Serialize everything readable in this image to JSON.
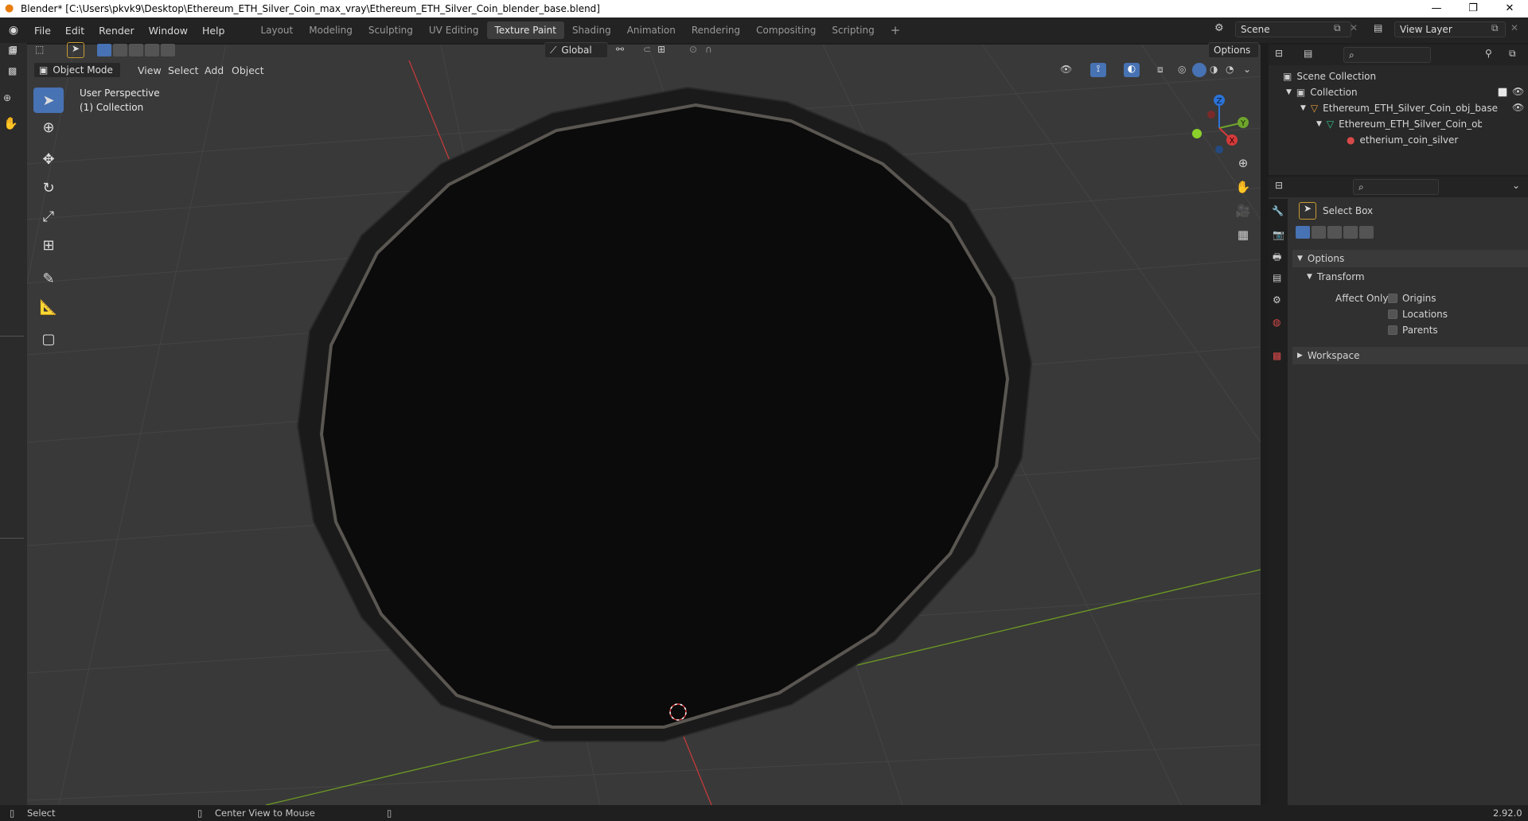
{
  "window": {
    "title": "Blender* [C:\\Users\\pkvk9\\Desktop\\Ethereum_ETH_Silver_Coin_max_vray\\Ethereum_ETH_Silver_Coin_blender_base.blend]"
  },
  "menu": {
    "items": [
      "File",
      "Edit",
      "Render",
      "Window",
      "Help"
    ]
  },
  "workspaces": {
    "tabs": [
      "Layout",
      "Modeling",
      "Sculpting",
      "UV Editing",
      "Texture Paint",
      "Shading",
      "Animation",
      "Rendering",
      "Compositing",
      "Scripting"
    ],
    "active": "Texture Paint",
    "add_label": "+"
  },
  "scene": {
    "scene_name": "Scene",
    "view_layer": "View Layer"
  },
  "viewport_header": {
    "mode": "Object Mode",
    "menus": [
      "View",
      "Select",
      "Add",
      "Object"
    ],
    "orientation": "Global",
    "options_label": "Options"
  },
  "viewport": {
    "perspective": "User Perspective",
    "collection": "(1) Collection",
    "gizmo": {
      "z": "Z",
      "y": "Y",
      "x": "X"
    },
    "colors": {
      "background": "#393939",
      "x_axis": "#c23a3a",
      "y_axis": "#6e9b22",
      "coin": "#0b0b0b"
    }
  },
  "outliner": {
    "root": "Scene Collection",
    "collection": "Collection",
    "object": "Ethereum_ETH_Silver_Coin_obj_base",
    "mesh": "Ethereum_ETH_Silver_Coin_obj_base",
    "material": "etherium_coin_silver"
  },
  "properties": {
    "tool_name": "Select Box",
    "options_header": "Options",
    "transform_header": "Transform",
    "affect_only_label": "Affect Only",
    "checks": [
      "Origins",
      "Locations",
      "Parents"
    ],
    "workspace_header": "Workspace"
  },
  "statusbar": {
    "select": "Select",
    "center_view": "Center View to Mouse",
    "version": "2.92.0"
  },
  "icons": {
    "window_min": "—",
    "window_max": "❐",
    "window_close": "✕"
  }
}
